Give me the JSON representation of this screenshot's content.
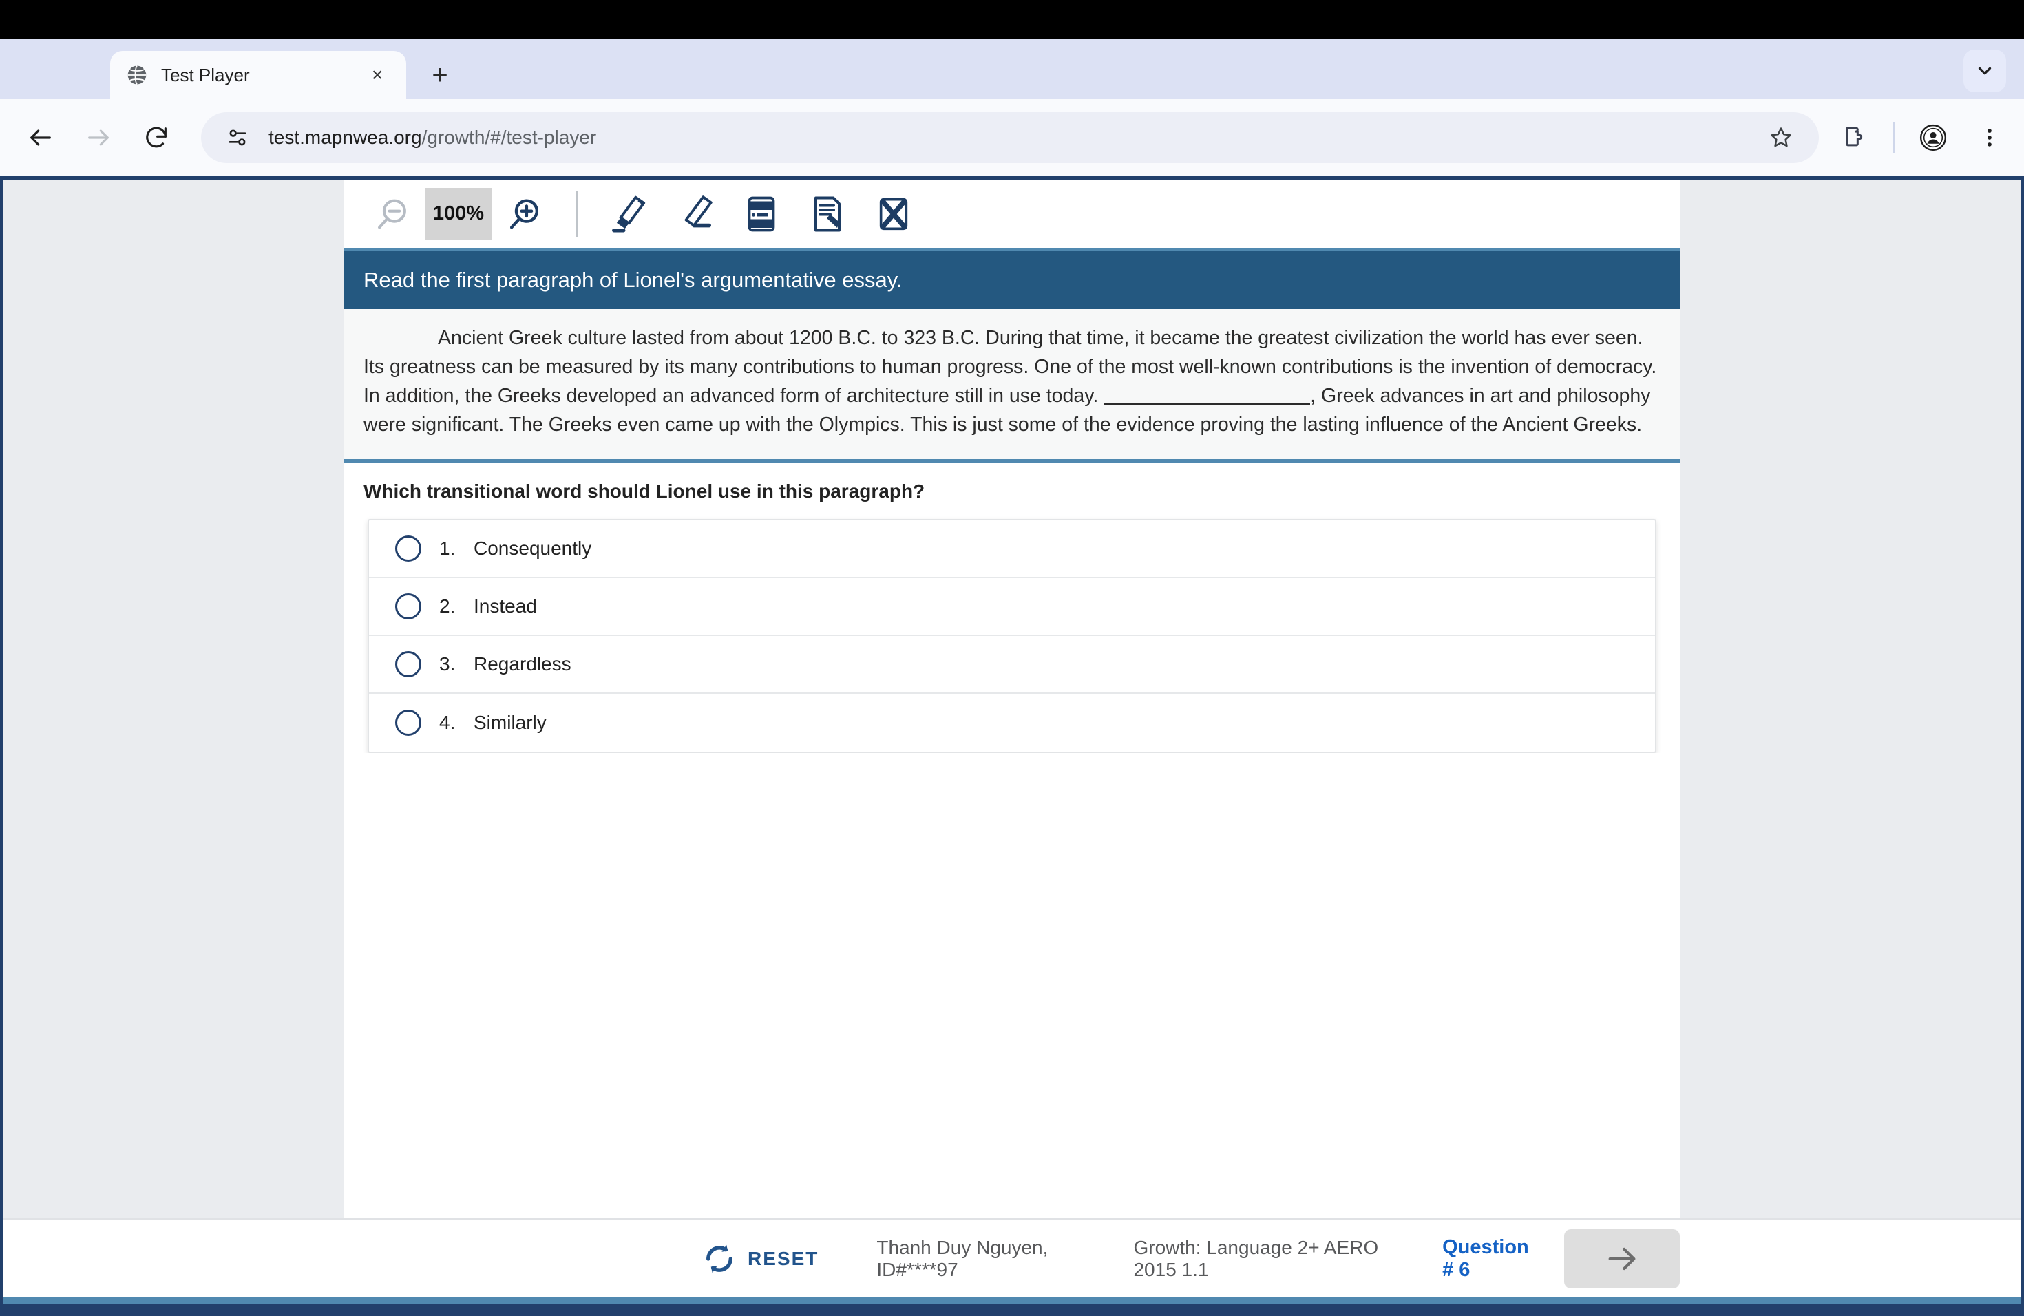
{
  "browser": {
    "tab": {
      "title": "Test Player",
      "favicon": "globe-icon",
      "close": "×"
    },
    "new_tab_label": "+",
    "url": "test.mapnwea.org",
    "url_path": "/growth/#/test-player",
    "icons": {
      "back": "back-arrow-icon",
      "forward": "forward-arrow-icon",
      "reload": "reload-icon",
      "site_info": "site-settings-icon",
      "bookmark": "star-icon",
      "extensions": "puzzle-piece-icon",
      "profile": "profile-avatar-icon",
      "menu": "three-dot-menu-icon",
      "tab_search": "chevron-down-icon"
    }
  },
  "toolbar": {
    "zoom_out_label": "zoom-out-icon",
    "zoom_level": "100%",
    "zoom_in_label": "zoom-in-icon",
    "tools": [
      {
        "name": "highlighter-tool",
        "title": "Highlighter"
      },
      {
        "name": "eraser-tool",
        "title": "Eraser"
      },
      {
        "name": "line-reader-tool",
        "title": "Line Reader"
      },
      {
        "name": "notepad-tool",
        "title": "Notepad"
      },
      {
        "name": "answer-eliminator-tool",
        "title": "Answer Eliminator"
      }
    ]
  },
  "passage": {
    "heading": "Read the first paragraph of Lionel's argumentative essay.",
    "text_before_blank": "Ancient Greek culture lasted from about 1200 B.C. to 323 B.C. During that time, it became the greatest civilization the world has ever seen. Its greatness can be measured by its many contributions to human progress. One of the most well-known contributions is the invention of democracy. In addition, the Greeks developed an advanced form of architecture still in use today. ",
    "text_after_blank": ", Greek advances in art and philosophy were significant. The Greeks even came up with the Olympics. This is just some of the evidence proving the lasting influence of the Ancient Greeks."
  },
  "question": {
    "stem": "Which transitional word should Lionel use in this paragraph?",
    "options": [
      {
        "number": "1.",
        "text": "Consequently",
        "selected": false
      },
      {
        "number": "2.",
        "text": "Instead",
        "selected": false
      },
      {
        "number": "3.",
        "text": "Regardless",
        "selected": false
      },
      {
        "number": "4.",
        "text": "Similarly",
        "selected": false
      }
    ]
  },
  "footer": {
    "reset_label": "RESET",
    "reset_icon": "refresh-circular-arrows-icon",
    "student": "Thanh Duy Nguyen, ID#****97",
    "test_name": "Growth: Language 2+ AERO 2015 1.1",
    "question_number": "Question # 6",
    "next_icon": "right-arrow-icon"
  },
  "colors": {
    "banner_blue": "#245880",
    "accent_blue": "#5089b0",
    "frame_navy": "#22406c",
    "link_blue": "#1562c5",
    "page_bg": "#eaecef"
  }
}
